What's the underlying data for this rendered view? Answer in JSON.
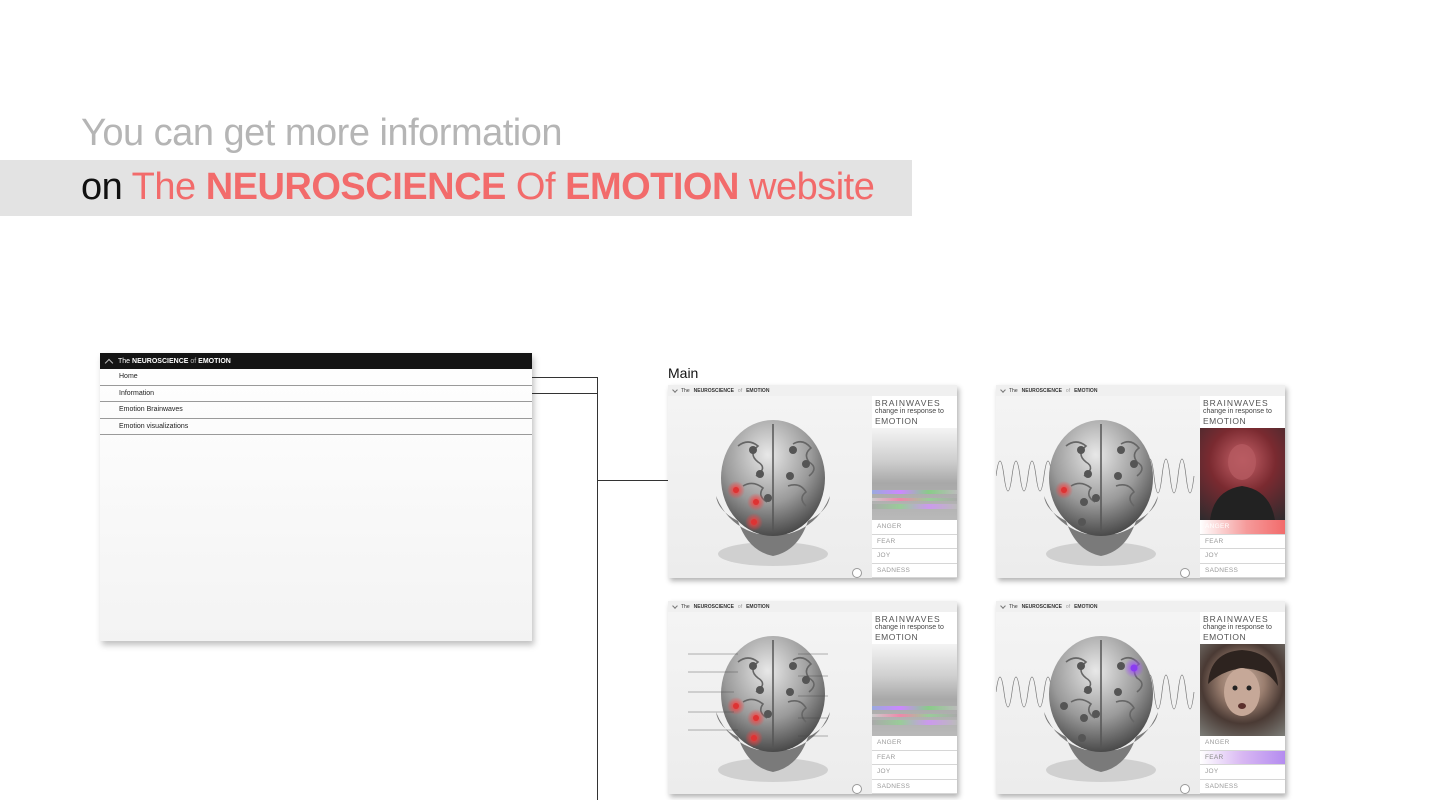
{
  "headline": {
    "line1": "You can get more information",
    "line2": {
      "prefix": "on",
      "the": "The",
      "neuroscience": "NEUROSCIENCE",
      "of": "Of",
      "emotion": "EMOTION",
      "suffix": "website"
    }
  },
  "menu_mock": {
    "title_the": "The",
    "title_neuro": "NEUROSCIENCE",
    "title_of": "of",
    "title_emotion": "EMOTION",
    "items": [
      "Home",
      "Information",
      "Emotion Brainwaves",
      "Emotion visualizations"
    ]
  },
  "main_label": "Main",
  "screens": [
    {
      "topbar": {
        "the": "The",
        "neuro": "NEUROSCIENCE",
        "of": "of",
        "emotion": "EMOTION"
      },
      "panel": {
        "title": "BRAINWAVES",
        "subtitle": "change in response to",
        "emotion": "EMOTION"
      },
      "emotions": [
        "ANGER",
        "FEAR",
        "JOY",
        "SADNESS"
      ],
      "media": "noise",
      "highlight": "none"
    },
    {
      "topbar": {
        "the": "The",
        "neuro": "NEUROSCIENCE",
        "of": "of",
        "emotion": "EMOTION"
      },
      "panel": {
        "title": "BRAINWAVES",
        "subtitle": "change in response to",
        "emotion": "EMOTION"
      },
      "emotions": [
        "ANGER",
        "FEAR",
        "JOY",
        "SADNESS"
      ],
      "media": "red-portrait",
      "highlight": "ANGER"
    },
    {
      "topbar": {
        "the": "The",
        "neuro": "NEUROSCIENCE",
        "of": "of",
        "emotion": "EMOTION"
      },
      "panel": {
        "title": "BRAINWAVES",
        "subtitle": "change in response to",
        "emotion": "EMOTION"
      },
      "emotions": [
        "ANGER",
        "FEAR",
        "JOY",
        "SADNESS"
      ],
      "media": "noise",
      "highlight": "none"
    },
    {
      "topbar": {
        "the": "The",
        "neuro": "NEUROSCIENCE",
        "of": "of",
        "emotion": "EMOTION"
      },
      "panel": {
        "title": "BRAINWAVES",
        "subtitle": "change in response to",
        "emotion": "EMOTION"
      },
      "emotions": [
        "ANGER",
        "FEAR",
        "JOY",
        "SADNESS"
      ],
      "media": "face-portrait",
      "highlight": "FEAR"
    }
  ],
  "colors": {
    "accent_red": "#f26b6b",
    "highlight_purple": "#b48cf0",
    "band_gray": "#e3e3e3",
    "menu_bar": "#141414"
  }
}
